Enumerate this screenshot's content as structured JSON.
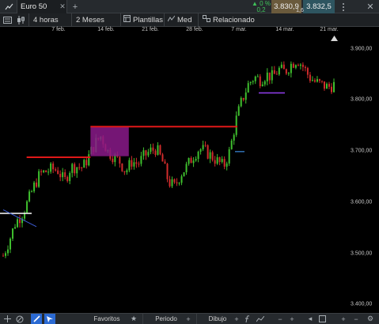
{
  "header": {
    "instrument_tab": "Euro 50",
    "change_pct": "0 %",
    "change_abs": "0,2",
    "bid": "3.830,9",
    "spread": "1,6",
    "ask": "3.832,5"
  },
  "toolbar": {
    "interval": "4 horas",
    "range": "2 Meses",
    "templates": "Plantillas",
    "indicator": "Med",
    "related": "Relacionado"
  },
  "date_labels": [
    "7 feb.",
    "14 feb.",
    "21 feb.",
    "28 feb.",
    "7 mar.",
    "14 mar.",
    "21 mar."
  ],
  "price_labels": [
    "3.900,00",
    "3.800,00",
    "3.700,00",
    "3.600,00",
    "3.500,00",
    "3.400,00"
  ],
  "footer": {
    "favorites": "Favoritos",
    "period": "Periodo",
    "drawing": "Dibujo"
  },
  "colors": {
    "candle_up": "#3fbf2e",
    "candle_down": "#d12c2c",
    "resistance_line": "#e01818",
    "highlight_box": "#8a1a8a",
    "ask_bg": "#2e5560",
    "bid_bg": "#6a5a3c",
    "accent": "#2b6ad3"
  },
  "chart_data": {
    "type": "candlestick",
    "x_axis": "date",
    "ylim": [
      3400,
      3920
    ],
    "y_ticks": [
      3900,
      3800,
      3700,
      3600,
      3500,
      3400
    ],
    "x_ticks": [
      "7 feb.",
      "14 feb.",
      "21 feb.",
      "28 feb.",
      "7 mar.",
      "14 mar.",
      "21 mar."
    ],
    "close_path": [
      3495,
      3525,
      3560,
      3575,
      3600,
      3630,
      3655,
      3660,
      3665,
      3662,
      3640,
      3668,
      3670,
      3668,
      3690,
      3715,
      3730,
      3700,
      3690,
      3680,
      3660,
      3680,
      3675,
      3690,
      3700,
      3705,
      3680,
      3640,
      3630,
      3655,
      3670,
      3690,
      3705,
      3700,
      3690,
      3680,
      3670,
      3700,
      3760,
      3800,
      3830,
      3845,
      3840,
      3850,
      3845,
      3860,
      3855,
      3870,
      3880,
      3865,
      3845,
      3835,
      3830,
      3825,
      3830
    ],
    "annotations": {
      "red_lines": [
        {
          "from": "2 feb.",
          "to": "12 feb.",
          "y": 3688
        },
        {
          "from": "12 feb.",
          "to": "7 mar.",
          "y": 3748
        }
      ],
      "purple_box": {
        "x_range": [
          "12 feb.",
          "18 feb."
        ],
        "y_range": [
          3690,
          3748
        ]
      },
      "white_line_y": 3578,
      "purple_line_y": 3814,
      "blue_tick_y": 3699
    }
  }
}
